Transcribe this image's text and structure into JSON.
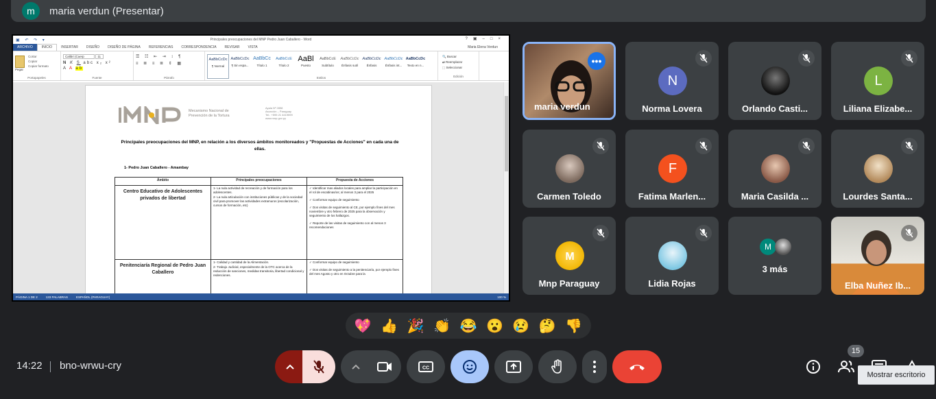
{
  "topbar": {
    "avatar_letter": "m",
    "title": "maria verdun (Presentar)",
    "avatar_color": "#00796b"
  },
  "word": {
    "window_title": "Principales preocupaciones del MNP Pedro Juan Caballero - Word",
    "tabs": [
      "ARCHIVO",
      "INICIO",
      "INSERTAR",
      "DISEÑO",
      "DISEÑO DE PÁGINA",
      "REFERENCIAS",
      "CORRESPONDENCIA",
      "REVISAR",
      "VISTA"
    ],
    "user": "Maria Elena Verdun",
    "clipboard": {
      "paste": "Pegar",
      "cut": "Cortar",
      "copy": "Copiar",
      "format": "Copiar formato",
      "label": "Portapapeles"
    },
    "font": {
      "name": "Calibri (Cuerp",
      "size": "11",
      "label": "Fuente"
    },
    "paragraph_label": "Párrafo",
    "styles": [
      {
        "sample": "AaBbCcDc",
        "name": "¶ Normal"
      },
      {
        "sample": "AaBbCcDc",
        "name": "¶ Sin espa..."
      },
      {
        "sample": "AaBbCc",
        "name": "Título 1"
      },
      {
        "sample": "AaBbCcE",
        "name": "Título 2"
      },
      {
        "sample": "AaBl",
        "name": "Puesto"
      },
      {
        "sample": "AaBbCcE",
        "name": "Subtítulo"
      },
      {
        "sample": "AaBbCcDc",
        "name": "Énfasis sutil"
      },
      {
        "sample": "AaBbCcDc",
        "name": "Énfasis"
      },
      {
        "sample": "AaBbCcDc",
        "name": "Énfasis int..."
      },
      {
        "sample": "AaBbCcDc",
        "name": "Texto en n..."
      }
    ],
    "styles_label": "Estilos",
    "edit": {
      "find": "Buscar",
      "replace": "Reemplazar",
      "select": "Seleccionar",
      "label": "Edición"
    },
    "statusbar": {
      "page": "PÁGINA 1 DE 2",
      "words": "133 PALABRAS",
      "lang": "ESPAÑOL (PARAGUAY)",
      "zoom": "100 %"
    }
  },
  "doc": {
    "logo": "MNP",
    "logo_text": [
      "Mecanismo Nacional de",
      "Prevención de la Tortura"
    ],
    "address": [
      "Ayala Nº 2858",
      "Asunción – Paraguay",
      "Tel.: +595 21 4419599",
      "www.mnp.gov.py"
    ],
    "heading": "Principales preocupaciones del MNP, en relación a los diversos ámbitos monitoreados y \"Propuestas de Acciones\" en cada una de ellas.",
    "section": "1-   Pedro Juan Caballero - Amambay",
    "table": {
      "headers": [
        "Ámbito",
        "Principales preocupaciones",
        "Propuesta de Acciones"
      ],
      "rows": [
        {
          "ambito": "Centro Educativo de Adolescentes privados de libertad",
          "preocupaciones": [
            "1-   La nula actividad de recreación y de formación para los adolescentes.",
            "2-   La nula articulación con instituciones públicas y de la sociedad civil para promover las actividades extramuros (escolarización, cursos de formación, etc)"
          ],
          "acciones": [
            "✓  Identificar mas aliados locales para ampliar la participación en el rol de escabinas/os; al menos 3 para el 2025",
            "✓  Conformar equipo de seguimiento",
            "✓  Dos visitas de seguimiento al CE, por ejemplo fines del mes noviembre y otro febrero de 2025 para la observación y seguimiento de los hallazgos.",
            "✓  Reporte de las visitas de seguimiento con al menos 3 recomendaciones"
          ]
        },
        {
          "ambito": "Penitenciaría Regional de Pedro Juan Caballero",
          "preocupaciones": [
            "1-   Calidad y cantidad de la Alimentación.",
            "2-   Trabajo Judicial, especialmente de la OTC acerca de la reducción de sanciones, medidas transitoria, libertad condicional y redenciones."
          ],
          "acciones": [
            "✓  Conformar equipo de seguimiento",
            "✓  Dos visitas de seguimiento a la penitenciaría, por ejemplo fines del mes Agosto y otro en Octubre para la"
          ]
        }
      ]
    }
  },
  "participants": [
    {
      "name": "maria verdun",
      "type": "video-maria",
      "active": true
    },
    {
      "name": "Norma Lovera",
      "letter": "N",
      "color": "#5c6bc0"
    },
    {
      "name": "Orlando Castillo",
      "display": "Orlando Casti...",
      "type": "photo",
      "color": "#2a2a2a"
    },
    {
      "name": "Liliana Elizabeth",
      "display": "Liliana Elizabe...",
      "letter": "L",
      "color": "#7cb342"
    },
    {
      "name": "Carmen Toledo",
      "type": "photo",
      "color": "#9e8f86"
    },
    {
      "name": "Fatima Marlene",
      "display": "Fatima Marlen...",
      "letter": "F",
      "color": "#f4511e"
    },
    {
      "name": "Maria Casilda",
      "display": "Maria Casilda ...",
      "type": "photo",
      "color": "#b58b78"
    },
    {
      "name": "Lourdes Santa",
      "display": "Lourdes Santa...",
      "type": "photo",
      "color": "#c4a07a"
    },
    {
      "name": "Mnp Paraguay",
      "type": "photo",
      "color": "#f2b705"
    },
    {
      "name": "Lidia Rojas",
      "type": "photo",
      "color": "#7ec8e3"
    },
    {
      "name": "3 más",
      "letter": "M",
      "color": "#00897b"
    },
    {
      "name": "Elba Nuñez Ibarra",
      "display": "Elba Nuñez Ib...",
      "type": "video-elba"
    }
  ],
  "reactions": [
    "💖",
    "👍",
    "🎉",
    "👏",
    "😂",
    "😮",
    "😢",
    "🤔",
    "👎"
  ],
  "bottom": {
    "time": "14:22",
    "meeting_code": "bno-wrwu-cry",
    "people_count": "15",
    "tooltip": "Mostrar escritorio"
  }
}
